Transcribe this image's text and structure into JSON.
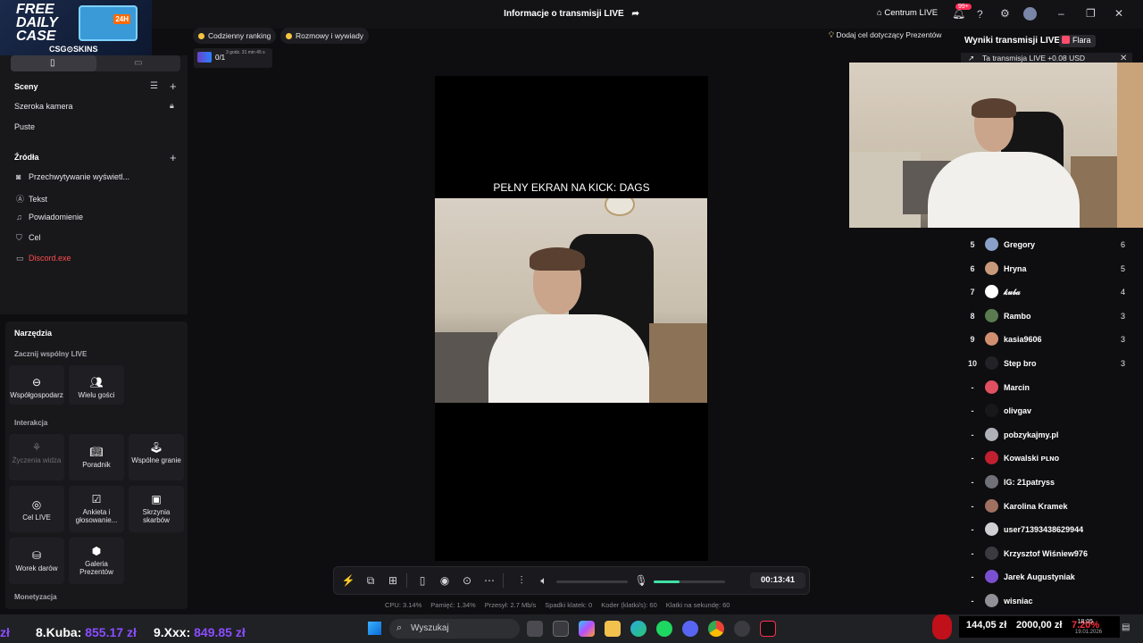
{
  "promo": {
    "line1": "FREE",
    "line2": "DAILY",
    "line3": "CASE",
    "box_label": "24H",
    "brand": "CSG⊙SKINS"
  },
  "titlebar": {
    "title": "Informacje o transmisji LIVE",
    "center_live": "Centrum LIVE",
    "notif_count": "99+"
  },
  "chips": {
    "ranking": "Codzienny ranking",
    "talks": "Rozmowy i wywiady",
    "goal_counter": "0/1",
    "goal_time": "3 godz. 31 min 45 s",
    "add_goal": "Dodaj cel dotyczący Prezentów"
  },
  "scenes": {
    "title": "Sceny",
    "items": [
      "Szeroka kamera",
      "Puste"
    ]
  },
  "sources": {
    "title": "Źródła",
    "items": [
      {
        "label": "Przechwytywanie wyświetl...",
        "icon": "camera-icon"
      },
      {
        "label": "Tekst",
        "icon": "text-icon"
      },
      {
        "label": "Powiadomienie",
        "icon": "bell-icon"
      },
      {
        "label": "Cel",
        "icon": "shield-icon"
      },
      {
        "label": "Discord.exe",
        "icon": "window-icon",
        "error": true
      }
    ]
  },
  "tools": {
    "title": "Narzędzia",
    "live_together": "Zacznij wspólny LIVE",
    "cohost": "Współgospodarz",
    "multi_guest": "Wielu gości",
    "interaction": "Interakcja",
    "wishes": "Życzenia widza",
    "guide": "Poradnik",
    "coplay": "Wspólne granie",
    "live_goal": "Cel LIVE",
    "poll": "Ankieta i głosowanie...",
    "treasure": "Skrzynia skarbów",
    "gift_bag": "Worek darów",
    "gift_gallery": "Galeria Prezentów",
    "monetization": "Monetyzacja"
  },
  "preview": {
    "overlay_text": "PEŁNY EKRAN NA KICK: DAGS"
  },
  "controls": {
    "timer": "00:13:41",
    "mic_level": 0.36,
    "stats": {
      "cpu": "CPU: 3.14%",
      "memory": "Pamięć: 1.34%",
      "bitrate": "Przesył: 2.7 Mb/s",
      "dropped": "Spadki klatek: 0",
      "encoder": "Koder (klatki/s): 60",
      "fps": "Klatki na sekundę: 60"
    }
  },
  "right": {
    "title": "Wyniki transmisji LIVE",
    "flare": "Flara",
    "banner": "Ta transmisja LIVE +0.08 USD",
    "ranking": [
      {
        "num": "5",
        "name": "Gregory",
        "score": "6",
        "color": "#8aa0c8"
      },
      {
        "num": "6",
        "name": "Hryna",
        "score": "5",
        "color": "#c89a7a"
      },
      {
        "num": "7",
        "name": "𝓀𝓊𝒷𝒶",
        "score": "4",
        "color": "#ffffff"
      },
      {
        "num": "8",
        "name": "Rambo",
        "score": "3",
        "color": "#5a7a50"
      },
      {
        "num": "9",
        "name": "kasia9606",
        "score": "3",
        "color": "#d09070"
      },
      {
        "num": "10",
        "name": "Step bro",
        "score": "3",
        "color": "#222226"
      },
      {
        "num": "-",
        "name": "Marcin",
        "score": "",
        "color": "#e05060"
      },
      {
        "num": "-",
        "name": "olivgav",
        "score": "",
        "color": "#18181b"
      },
      {
        "num": "-",
        "name": "pobzykajmy.pl",
        "score": "",
        "color": "#b0b0b8"
      },
      {
        "num": "-",
        "name": "Kowalski ᴘʟɴᴏ",
        "score": "",
        "color": "#c02030"
      },
      {
        "num": "-",
        "name": "IG: 21patryss",
        "score": "",
        "color": "#707078"
      },
      {
        "num": "-",
        "name": "Karolina Kramek",
        "score": "",
        "color": "#a07060"
      },
      {
        "num": "-",
        "name": "user71393438629944",
        "score": "",
        "color": "#d0d0d4"
      },
      {
        "num": "-",
        "name": "Krzysztof Wiśniew976",
        "score": "",
        "color": "#3a3a40"
      },
      {
        "num": "-",
        "name": "Jarek Augustyniak",
        "score": "",
        "color": "#7a50d0"
      },
      {
        "num": "-",
        "name": "wisniac",
        "score": "",
        "color": "#909098"
      }
    ]
  },
  "taskbar": {
    "ticker_a": "zł",
    "ticker_b_rank": "8.Kuba:",
    "ticker_b_val": "855.17 zł",
    "ticker_c_rank": "9.Xxx:",
    "ticker_c_val": "849.85 zł",
    "search": "Wyszukaj",
    "donation_a": "144,05 zł",
    "donation_b": "2000,00 zł",
    "donation_pct": "7.20%",
    "clock_time": "18:05",
    "clock_date": "19.01.2026"
  }
}
